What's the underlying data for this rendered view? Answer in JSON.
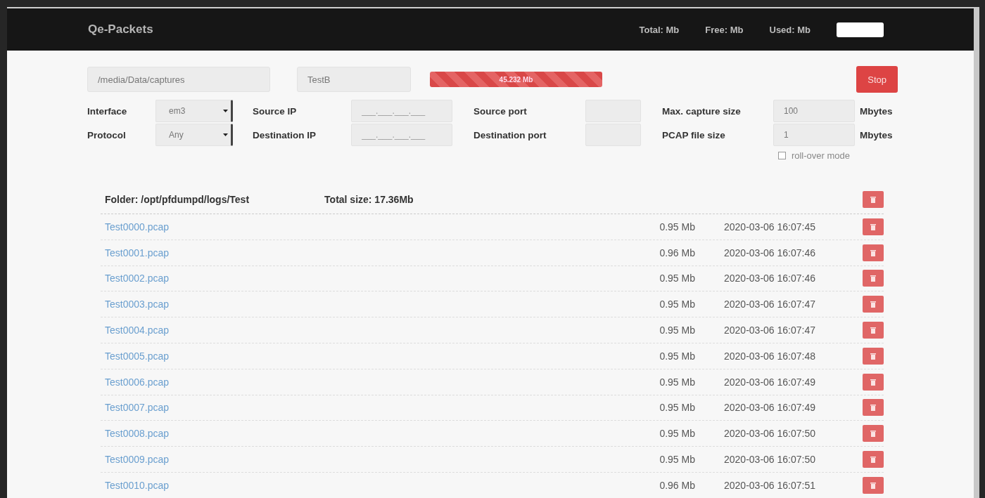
{
  "header": {
    "title": "Qe-Packets",
    "stats": [
      "Total: Mb",
      "Free: Mb",
      "Used: Mb"
    ]
  },
  "capture": {
    "path": "/media/Data/captures",
    "name": "TestB",
    "progress": {
      "level": 1,
      "reading": "45.232 Mb"
    },
    "stop_button": "Stop"
  },
  "filters": [
    {
      "label": "Interface",
      "kind": "select",
      "value": "em3"
    },
    {
      "label": "Source IP",
      "kind": "input",
      "placeholder": "___.___.___.___"
    },
    {
      "label": "Source port",
      "kind": "input"
    },
    {
      "label": "Max. capture size",
      "kind": "input",
      "value": "100",
      "unit": "Mbytes"
    },
    {
      "label": "Protocol",
      "kind": "select",
      "value": "Any"
    },
    {
      "label": "Destination IP",
      "kind": "input",
      "placeholder": "___.___.___.___"
    },
    {
      "label": "Destination port",
      "kind": "input"
    },
    {
      "label": "PCAP file size",
      "kind": "input",
      "value": "1",
      "unit": "Mbytes"
    }
  ],
  "rollover": {
    "label": "roll-over mode",
    "checked": false
  },
  "folder": {
    "path": "Folder: /opt/pfdumpd/logs/Test",
    "total": "Total size: 17.36Mb"
  },
  "files": [
    {
      "name": "Test0000.pcap",
      "size": "0.95 Mb",
      "date": "2020-03-06 16:07:45"
    },
    {
      "name": "Test0001.pcap",
      "size": "0.96 Mb",
      "date": "2020-03-06 16:07:46"
    },
    {
      "name": "Test0002.pcap",
      "size": "0.95 Mb",
      "date": "2020-03-06 16:07:46"
    },
    {
      "name": "Test0003.pcap",
      "size": "0.95 Mb",
      "date": "2020-03-06 16:07:47"
    },
    {
      "name": "Test0004.pcap",
      "size": "0.95 Mb",
      "date": "2020-03-06 16:07:47"
    },
    {
      "name": "Test0005.pcap",
      "size": "0.95 Mb",
      "date": "2020-03-06 16:07:48"
    },
    {
      "name": "Test0006.pcap",
      "size": "0.95 Mb",
      "date": "2020-03-06 16:07:49"
    },
    {
      "name": "Test0007.pcap",
      "size": "0.95 Mb",
      "date": "2020-03-06 16:07:49"
    },
    {
      "name": "Test0008.pcap",
      "size": "0.95 Mb",
      "date": "2020-03-06 16:07:50"
    },
    {
      "name": "Test0009.pcap",
      "size": "0.95 Mb",
      "date": "2020-03-06 16:07:50"
    },
    {
      "name": "Test0010.pcap",
      "size": "0.96 Mb",
      "date": "2020-03-06 16:07:51"
    }
  ]
}
